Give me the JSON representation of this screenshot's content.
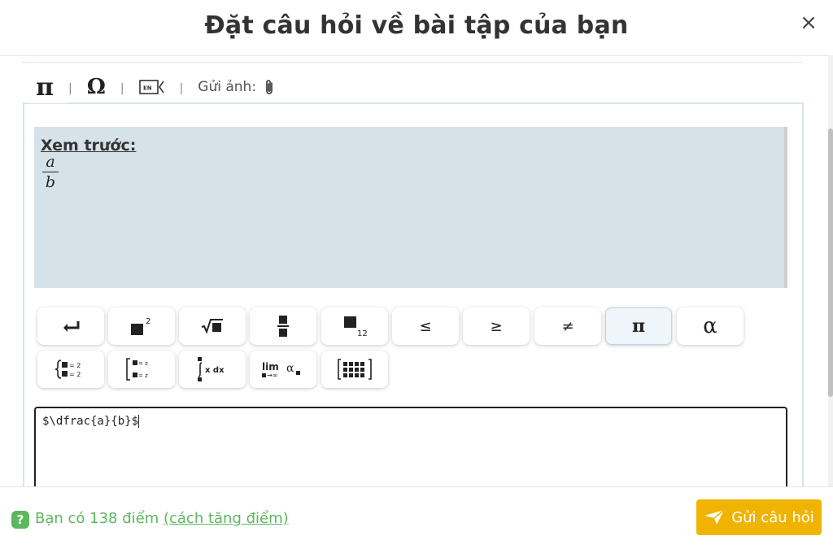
{
  "dialog": {
    "title": "Đặt câu hỏi về bài tập của bạn",
    "close_icon": "×"
  },
  "toolbar": {
    "pi_tab": "π",
    "omega_tab": "Ω",
    "separator": "|",
    "language_icon": "EN",
    "upload_label": "Gửi ảnh:"
  },
  "preview": {
    "label": "Xem trước:",
    "numerator": "a",
    "denominator": "b"
  },
  "math_buttons": {
    "row1": [
      {
        "name": "enter",
        "icon": "return-icon"
      },
      {
        "name": "superscript",
        "icon": "superscript-icon",
        "text": "2"
      },
      {
        "name": "sqrt",
        "icon": "sqrt-icon"
      },
      {
        "name": "fraction",
        "icon": "fraction-icon"
      },
      {
        "name": "subscript",
        "icon": "subscript-icon",
        "text": "12"
      },
      {
        "name": "leq",
        "text": "≤"
      },
      {
        "name": "geq",
        "text": "≥"
      },
      {
        "name": "neq",
        "text": "≠"
      },
      {
        "name": "pi",
        "text": "π",
        "active": true
      },
      {
        "name": "alpha",
        "text": "α"
      }
    ],
    "row2": [
      {
        "name": "system",
        "icon": "system-icon",
        "text": "= 2"
      },
      {
        "name": "bracket-system",
        "icon": "bracket-system-icon",
        "text": "= z"
      },
      {
        "name": "integral",
        "icon": "integral-icon",
        "text": "x dx"
      },
      {
        "name": "limit",
        "icon": "limit-icon",
        "text": "lim",
        "sub": "→∞",
        "extra": "α"
      },
      {
        "name": "matrix",
        "icon": "matrix-icon"
      }
    ]
  },
  "editor": {
    "value": "$\\dfrac{a}{b}$"
  },
  "footer": {
    "help_icon": "?",
    "points_text": "Bạn có 138 điểm ",
    "points_link": "(cách tăng điểm)",
    "send_label": "Gửi câu hỏi"
  },
  "colors": {
    "accent_yellow": "#f0b400",
    "points_green": "#5cb85c",
    "preview_bg": "#d5e3e9"
  }
}
